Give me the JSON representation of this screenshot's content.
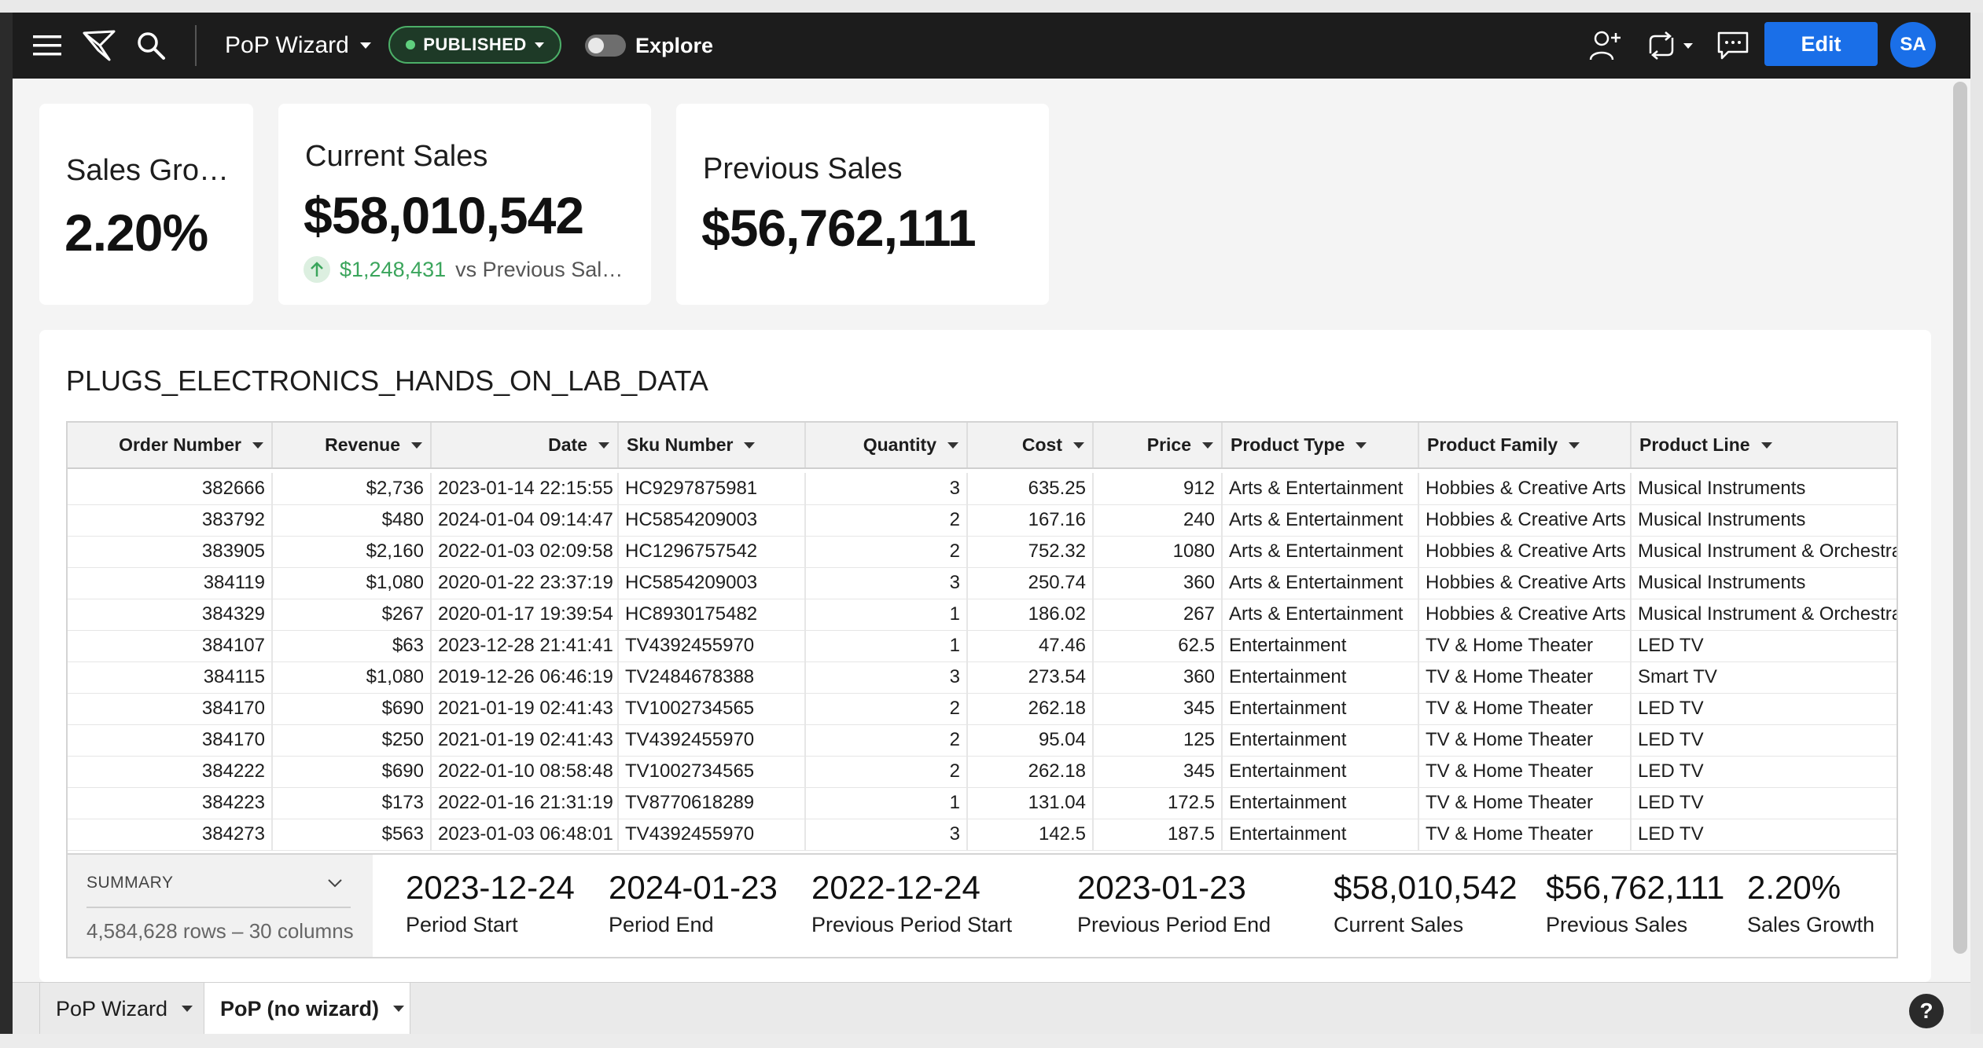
{
  "header": {
    "workbook_title": "PoP Wizard",
    "status_badge": "PUBLISHED",
    "explore_label": "Explore",
    "edit_label": "Edit",
    "avatar_initials": "SA",
    "accent_color": "#1a6fe8",
    "published_color": "#4caf68",
    "icons": [
      "menu-icon",
      "sigma-logo-icon",
      "search-icon",
      "add-user-icon",
      "sync-icon",
      "comment-icon"
    ]
  },
  "kpis": {
    "growth": {
      "title": "Sales Gro…",
      "value": "2.20%"
    },
    "current": {
      "title": "Current Sales",
      "value": "$58,010,542",
      "delta_value": "$1,248,431",
      "delta_text": "vs Previous Sal…",
      "delta_color": "#3ba55c"
    },
    "previous": {
      "title": "Previous Sales",
      "value": "$56,762,111"
    }
  },
  "table": {
    "title": "PLUGS_ELECTRONICS_HANDS_ON_LAB_DATA",
    "columns": [
      "Order Number",
      "Revenue",
      "Date",
      "Sku Number",
      "Quantity",
      "Cost",
      "Price",
      "Product Type",
      "Product Family",
      "Product Line"
    ],
    "rows": [
      [
        "382666",
        "$2,736",
        "2023-01-14 22:15:55",
        "HC9297875981",
        "3",
        "635.25",
        "912",
        "Arts & Entertainment",
        "Hobbies & Creative Arts",
        "Musical Instruments"
      ],
      [
        "383792",
        "$480",
        "2024-01-04 09:14:47",
        "HC5854209003",
        "2",
        "167.16",
        "240",
        "Arts & Entertainment",
        "Hobbies & Creative Arts",
        "Musical Instruments"
      ],
      [
        "383905",
        "$2,160",
        "2022-01-03 02:09:58",
        "HC1296757542",
        "2",
        "752.32",
        "1080",
        "Arts & Entertainment",
        "Hobbies & Creative Arts",
        "Musical Instrument & Orchestra"
      ],
      [
        "384119",
        "$1,080",
        "2020-01-22 23:37:19",
        "HC5854209003",
        "3",
        "250.74",
        "360",
        "Arts & Entertainment",
        "Hobbies & Creative Arts",
        "Musical Instruments"
      ],
      [
        "384329",
        "$267",
        "2020-01-17 19:39:54",
        "HC8930175482",
        "1",
        "186.02",
        "267",
        "Arts & Entertainment",
        "Hobbies & Creative Arts",
        "Musical Instrument & Orchestra"
      ],
      [
        "384107",
        "$63",
        "2023-12-28 21:41:41",
        "TV4392455970",
        "1",
        "47.46",
        "62.5",
        "Entertainment",
        "TV & Home Theater",
        "LED TV"
      ],
      [
        "384115",
        "$1,080",
        "2019-12-26 06:46:19",
        "TV2484678388",
        "3",
        "273.54",
        "360",
        "Entertainment",
        "TV & Home Theater",
        "Smart TV"
      ],
      [
        "384170",
        "$690",
        "2021-01-19 02:41:43",
        "TV1002734565",
        "2",
        "262.18",
        "345",
        "Entertainment",
        "TV & Home Theater",
        "LED TV"
      ],
      [
        "384170",
        "$250",
        "2021-01-19 02:41:43",
        "TV4392455970",
        "2",
        "95.04",
        "125",
        "Entertainment",
        "TV & Home Theater",
        "LED TV"
      ],
      [
        "384222",
        "$690",
        "2022-01-10 08:58:48",
        "TV1002734565",
        "2",
        "262.18",
        "345",
        "Entertainment",
        "TV & Home Theater",
        "LED TV"
      ],
      [
        "384223",
        "$173",
        "2022-01-16 21:31:19",
        "TV8770618289",
        "1",
        "131.04",
        "172.5",
        "Entertainment",
        "TV & Home Theater",
        "LED TV"
      ],
      [
        "384273",
        "$563",
        "2023-01-03 06:48:01",
        "TV4392455970",
        "3",
        "142.5",
        "187.5",
        "Entertainment",
        "TV & Home Theater",
        "LED TV"
      ]
    ]
  },
  "summary": {
    "label": "SUMMARY",
    "rows_text": "4,584,628 rows – 30 columns",
    "items": [
      {
        "value": "2023-12-24",
        "label": "Period Start"
      },
      {
        "value": "2024-01-23",
        "label": "Period End"
      },
      {
        "value": "2022-12-24",
        "label": "Previous Period Start"
      },
      {
        "value": "2023-01-23",
        "label": "Previous Period End"
      },
      {
        "value": "$58,010,542",
        "label": "Current Sales"
      },
      {
        "value": "$56,762,111",
        "label": "Previous Sales"
      },
      {
        "value": "2.20%",
        "label": "Sales Growth"
      }
    ]
  },
  "pages": {
    "tabs": [
      {
        "label": "PoP Wizard"
      },
      {
        "label": "PoP (no wizard)"
      }
    ],
    "help_label": "?"
  }
}
